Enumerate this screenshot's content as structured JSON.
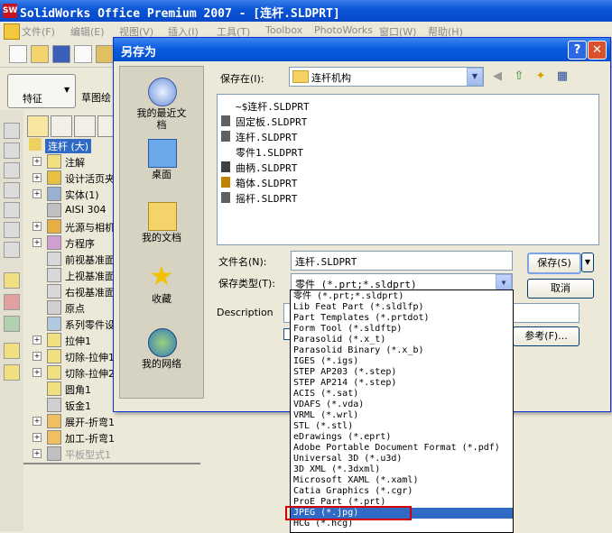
{
  "app": {
    "title": "SolidWorks Office Premium 2007 - [连杆.SLDPRT]",
    "logo": "SW",
    "menu": [
      "文件(F)",
      "编辑(E)",
      "视图(V)",
      "插入(I)",
      "工具(T)",
      "Toolbox",
      "PhotoWorks",
      "窗口(W)",
      "帮助(H)"
    ],
    "feature_button_label": "特征",
    "sketch_label": "草图绘"
  },
  "tree": {
    "root": "连杆  (大)",
    "items": [
      {
        "label": "注解",
        "expand": "+"
      },
      {
        "label": "设计活页夹",
        "expand": "+"
      },
      {
        "label": "实体(1)",
        "expand": "+"
      },
      {
        "label": "AISI 304",
        "expand": ""
      },
      {
        "label": "光源与相机",
        "expand": "+"
      },
      {
        "label": "方程序",
        "expand": "+"
      },
      {
        "label": "前视基准面",
        "expand": ""
      },
      {
        "label": "上视基准面",
        "expand": ""
      },
      {
        "label": "右视基准面",
        "expand": ""
      },
      {
        "label": "原点",
        "expand": ""
      },
      {
        "label": "系列零件设计表",
        "expand": ""
      },
      {
        "label": "拉伸1",
        "expand": "+"
      },
      {
        "label": "切除-拉伸1",
        "expand": "+"
      },
      {
        "label": "切除-拉伸2",
        "expand": "+"
      },
      {
        "label": "圆角1",
        "expand": ""
      },
      {
        "label": "钣金1",
        "expand": ""
      },
      {
        "label": "展开-折弯1",
        "expand": "+"
      },
      {
        "label": "加工-折弯1",
        "expand": "+"
      },
      {
        "label": "平板型式1",
        "expand": "+"
      }
    ]
  },
  "dialog": {
    "title": "另存为",
    "help": "?",
    "close": "✕",
    "places": [
      "我的最近文档",
      "桌面",
      "我的文档",
      "收藏",
      "我的网络"
    ],
    "save_in_label": "保存在(I):",
    "save_in_value": "连杆机构",
    "files": [
      "~$连杆.SLDPRT",
      "固定板.SLDPRT",
      "连杆.SLDPRT",
      "零件1.SLDPRT",
      "曲柄.SLDPRT",
      "箱体.SLDPRT",
      "摇杆.SLDPRT"
    ],
    "filename_label": "文件名(N):",
    "filename_value": "连杆.SLDPRT",
    "filetype_label": "保存类型(T):",
    "filetype_value": "零件 (*.prt;*.sldprt)",
    "description_label": "Description",
    "save_button": "保存(S)",
    "cancel_button": "取消",
    "browse_button": "参考(F)..."
  },
  "file_types": [
    "零件 (*.prt;*.sldprt)",
    "Lib Feat Part (*.sldlfp)",
    "Part Templates (*.prtdot)",
    "Form Tool (*.sldftp)",
    "Parasolid (*.x_t)",
    "Parasolid Binary (*.x_b)",
    "IGES (*.igs)",
    "STEP AP203 (*.step)",
    "STEP AP214 (*.step)",
    "ACIS (*.sat)",
    "VDAFS (*.vda)",
    "VRML (*.wrl)",
    "STL (*.stl)",
    "eDrawings (*.eprt)",
    "Adobe Portable Document Format (*.pdf)",
    "Universal 3D (*.u3d)",
    "3D XML (*.3dxml)",
    "Microsoft XAML (*.xaml)",
    "Catia Graphics (*.cgr)",
    "ProE Part (*.prt)",
    "JPEG (*.jpg)",
    "HCG (*.hcg)"
  ],
  "selected_file_type": "JPEG (*.jpg)",
  "colors": {
    "titlebar": "#0a54d6",
    "selection": "#316ac5",
    "highlight_box": "#d40000"
  }
}
